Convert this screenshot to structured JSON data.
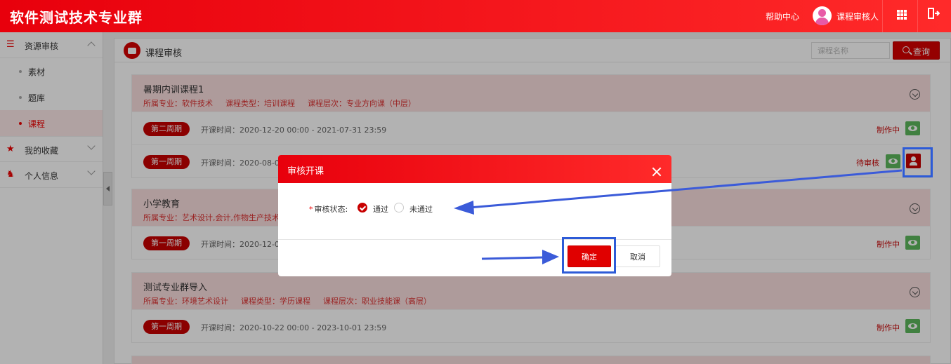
{
  "header": {
    "app_title": "软件测试技术专业群",
    "help": "帮助中心",
    "user_name": "课程审核人",
    "icons": [
      "grid-icon",
      "exit-icon"
    ],
    "colors": {
      "brand": "#e8000c"
    }
  },
  "sidebar": {
    "groups": [
      {
        "label": "资源审核",
        "icon": "list-icon",
        "expanded": true,
        "items": [
          {
            "label": "素材",
            "active": false
          },
          {
            "label": "题库",
            "active": false
          },
          {
            "label": "课程",
            "active": true
          }
        ]
      },
      {
        "label": "我的收藏",
        "icon": "star-icon",
        "expanded": false
      },
      {
        "label": "个人信息",
        "icon": "user-card-icon",
        "expanded": false
      }
    ]
  },
  "panel": {
    "title": "课程审核",
    "search_placeholder": "课程名称",
    "search_button": "查询"
  },
  "courses": [
    {
      "name": "暑期内训课程1",
      "major": "所属专业：软件技术",
      "type": "课程类型：培训课程",
      "level": "课程层次：专业方向课（中层）",
      "periods": [
        {
          "tag": "第二周期",
          "time": "开课时间：2020-12-20 00:00 - 2021-07-31 23:59",
          "status": "制作中"
        },
        {
          "tag": "第一周期",
          "time": "开课时间：2020-08-0",
          "status": "待审核"
        }
      ]
    },
    {
      "name": "小学教育",
      "major": "所属专业：艺术设计,会计,作物生产技术",
      "type": "",
      "level": "",
      "periods": [
        {
          "tag": "第一周期",
          "time": "开课时间：2020-12-0",
          "status": "制作中"
        }
      ]
    },
    {
      "name": "测试专业群导入",
      "major": "所属专业：环境艺术设计",
      "type": "课程类型：学历课程",
      "level": "课程层次：职业技能课（高层）",
      "periods": [
        {
          "tag": "第一周期",
          "time": "开课时间：2020-10-22 00:00 - 2023-10-01 23:59",
          "status": "制作中"
        }
      ]
    }
  ],
  "modal": {
    "title": "审核开课",
    "field_label": "审核状态:",
    "required_mark": "*",
    "options": [
      {
        "label": "通过",
        "checked": true
      },
      {
        "label": "未通过",
        "checked": false
      }
    ],
    "confirm": "确定",
    "cancel": "取消"
  }
}
